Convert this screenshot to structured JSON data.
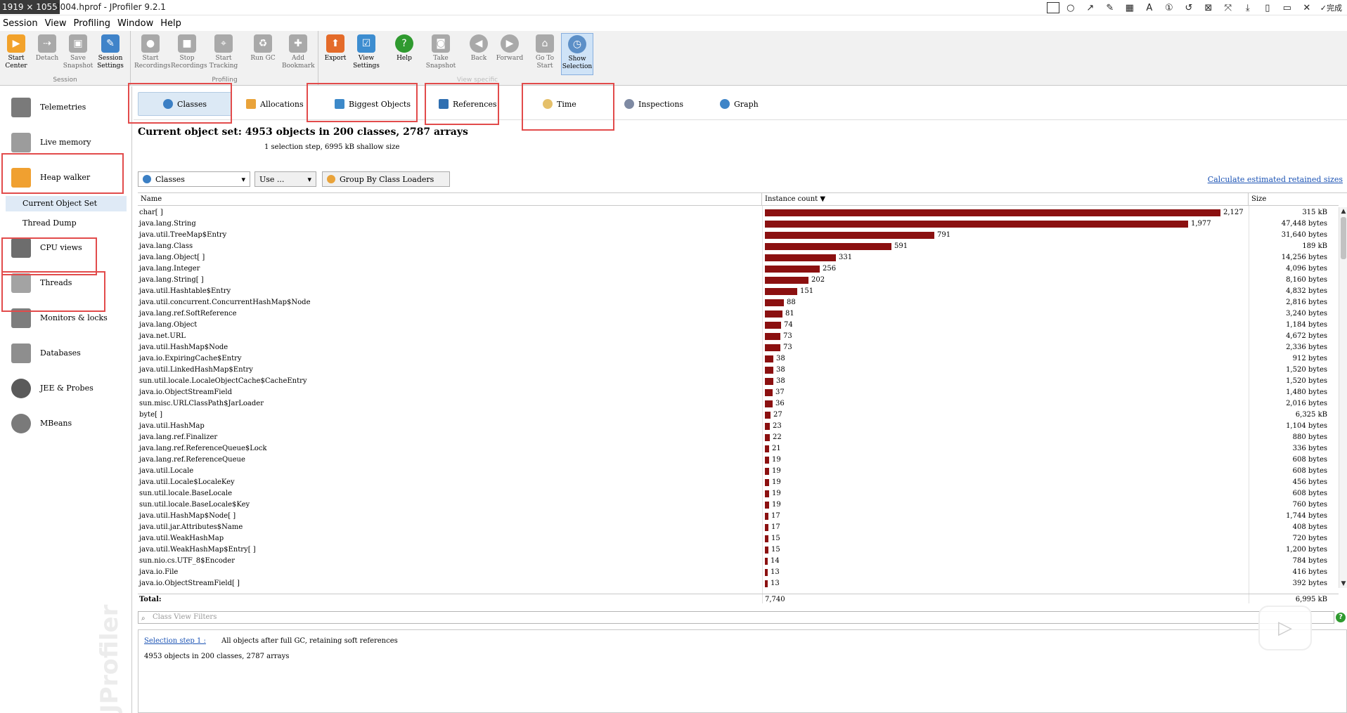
{
  "titlebar": {
    "dim_badge": "1919 × 1055",
    "title": "3004.hprof - JProfiler 9.2.1",
    "finish_label": "完成"
  },
  "menu": [
    "Session",
    "View",
    "Profiling",
    "Window",
    "Help"
  ],
  "toolbar": {
    "session": {
      "label": "Session",
      "buttons": [
        "Start Center",
        "Detach",
        "Save Snapshot",
        "Session Settings"
      ]
    },
    "profiling": {
      "label": "Profiling",
      "buttons": [
        "Start Recordings",
        "Stop Recordings",
        "Start Tracking",
        "Run GC",
        "Add Bookmark"
      ]
    },
    "view_specific": {
      "label": "View specific",
      "buttons": [
        "Export",
        "View Settings",
        "Help",
        "Take Snapshot",
        "Back",
        "Forward",
        "Go To Start",
        "Show Selection"
      ]
    }
  },
  "nav": {
    "items": [
      "Telemetries",
      "Live memory",
      "Heap walker",
      "CPU views",
      "Threads",
      "Monitors & locks",
      "Databases",
      "JEE & Probes",
      "MBeans"
    ],
    "heap_sub": [
      "Current Object Set",
      "Thread Dump"
    ]
  },
  "watermark": "JProfiler",
  "view_tabs": [
    "Classes",
    "Allocations",
    "Biggest Objects",
    "References",
    "Time",
    "Inspections",
    "Graph"
  ],
  "object_set": {
    "title": "Current object set: 4953 objects in 200 classes, 2787 arrays",
    "subtitle": "1 selection step, 6995 kB shallow size"
  },
  "controls": {
    "view_select": "Classes",
    "use_label": "Use ...",
    "group_label": "Group By Class Loaders",
    "retain_link": "Calculate estimated retained sizes"
  },
  "table": {
    "headers": [
      "Name",
      "Instance count ▼",
      "Size"
    ],
    "max_count": 2127,
    "rows": [
      {
        "name": "char[ ]",
        "count": 2127,
        "count_label": "2,127",
        "size": "315 kB"
      },
      {
        "name": "java.lang.String",
        "count": 1977,
        "count_label": "1,977",
        "size": "47,448 bytes"
      },
      {
        "name": "java.util.TreeMap$Entry",
        "count": 791,
        "count_label": "791",
        "size": "31,640 bytes"
      },
      {
        "name": "java.lang.Class",
        "count": 591,
        "count_label": "591",
        "size": "189 kB"
      },
      {
        "name": "java.lang.Object[ ]",
        "count": 331,
        "count_label": "331",
        "size": "14,256 bytes"
      },
      {
        "name": "java.lang.Integer",
        "count": 256,
        "count_label": "256",
        "size": "4,096 bytes"
      },
      {
        "name": "java.lang.String[ ]",
        "count": 202,
        "count_label": "202",
        "size": "8,160 bytes"
      },
      {
        "name": "java.util.Hashtable$Entry",
        "count": 151,
        "count_label": "151",
        "size": "4,832 bytes"
      },
      {
        "name": "java.util.concurrent.ConcurrentHashMap$Node",
        "count": 88,
        "count_label": "88",
        "size": "2,816 bytes"
      },
      {
        "name": "java.lang.ref.SoftReference",
        "count": 81,
        "count_label": "81",
        "size": "3,240 bytes"
      },
      {
        "name": "java.lang.Object",
        "count": 74,
        "count_label": "74",
        "size": "1,184 bytes"
      },
      {
        "name": "java.net.URL",
        "count": 73,
        "count_label": "73",
        "size": "4,672 bytes"
      },
      {
        "name": "java.util.HashMap$Node",
        "count": 73,
        "count_label": "73",
        "size": "2,336 bytes"
      },
      {
        "name": "java.io.ExpiringCache$Entry",
        "count": 38,
        "count_label": "38",
        "size": "912 bytes"
      },
      {
        "name": "java.util.LinkedHashMap$Entry",
        "count": 38,
        "count_label": "38",
        "size": "1,520 bytes"
      },
      {
        "name": "sun.util.locale.LocaleObjectCache$CacheEntry",
        "count": 38,
        "count_label": "38",
        "size": "1,520 bytes"
      },
      {
        "name": "java.io.ObjectStreamField",
        "count": 37,
        "count_label": "37",
        "size": "1,480 bytes"
      },
      {
        "name": "sun.misc.URLClassPath$JarLoader",
        "count": 36,
        "count_label": "36",
        "size": "2,016 bytes"
      },
      {
        "name": "byte[ ]",
        "count": 27,
        "count_label": "27",
        "size": "6,325 kB"
      },
      {
        "name": "java.util.HashMap",
        "count": 23,
        "count_label": "23",
        "size": "1,104 bytes"
      },
      {
        "name": "java.lang.ref.Finalizer",
        "count": 22,
        "count_label": "22",
        "size": "880 bytes"
      },
      {
        "name": "java.lang.ref.ReferenceQueue$Lock",
        "count": 21,
        "count_label": "21",
        "size": "336 bytes"
      },
      {
        "name": "java.lang.ref.ReferenceQueue",
        "count": 19,
        "count_label": "19",
        "size": "608 bytes"
      },
      {
        "name": "java.util.Locale",
        "count": 19,
        "count_label": "19",
        "size": "608 bytes"
      },
      {
        "name": "java.util.Locale$LocaleKey",
        "count": 19,
        "count_label": "19",
        "size": "456 bytes"
      },
      {
        "name": "sun.util.locale.BaseLocale",
        "count": 19,
        "count_label": "19",
        "size": "608 bytes"
      },
      {
        "name": "sun.util.locale.BaseLocale$Key",
        "count": 19,
        "count_label": "19",
        "size": "760 bytes"
      },
      {
        "name": "java.util.HashMap$Node[ ]",
        "count": 17,
        "count_label": "17",
        "size": "1,744 bytes"
      },
      {
        "name": "java.util.jar.Attributes$Name",
        "count": 17,
        "count_label": "17",
        "size": "408 bytes"
      },
      {
        "name": "java.util.WeakHashMap",
        "count": 15,
        "count_label": "15",
        "size": "720 bytes"
      },
      {
        "name": "java.util.WeakHashMap$Entry[ ]",
        "count": 15,
        "count_label": "15",
        "size": "1,200 bytes"
      },
      {
        "name": "sun.nio.cs.UTF_8$Encoder",
        "count": 14,
        "count_label": "14",
        "size": "784 bytes"
      },
      {
        "name": "java.io.File",
        "count": 13,
        "count_label": "13",
        "size": "416 bytes"
      },
      {
        "name": "java.io.ObjectStreamField[ ]",
        "count": 13,
        "count_label": "13",
        "size": "392 bytes"
      }
    ],
    "total": {
      "label": "Total:",
      "count": "7,740",
      "size": "6,995 kB"
    }
  },
  "filter": {
    "placeholder": "Class View Filters"
  },
  "bottom": {
    "step_link": "Selection step 1 :",
    "step_desc": "All objects after full GC, retaining soft references",
    "summary": "4953 objects in 200 classes, 2787 arrays"
  },
  "colors": {
    "bar": "#8b1010",
    "highlight": "#e24b4b",
    "link": "#1a52b4",
    "tab_selected": "#dce9f5"
  }
}
